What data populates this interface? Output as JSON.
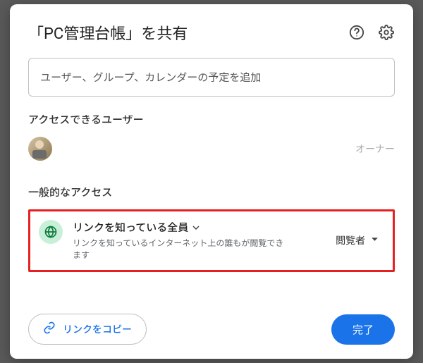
{
  "dialog": {
    "title": "「PC管理台帳」を共有"
  },
  "input": {
    "placeholder": "ユーザー、グループ、カレンダーの予定を追加"
  },
  "sections": {
    "access_label": "アクセスできるユーザー",
    "owner_label": "オーナー",
    "general_label": "一般的なアクセス"
  },
  "general_access": {
    "title": "リンクを知っている全員",
    "description": "リンクを知っているインターネット上の誰もが閲覧できます",
    "role": "閲覧者"
  },
  "footer": {
    "copy_link": "リンクをコピー",
    "done": "完了"
  }
}
